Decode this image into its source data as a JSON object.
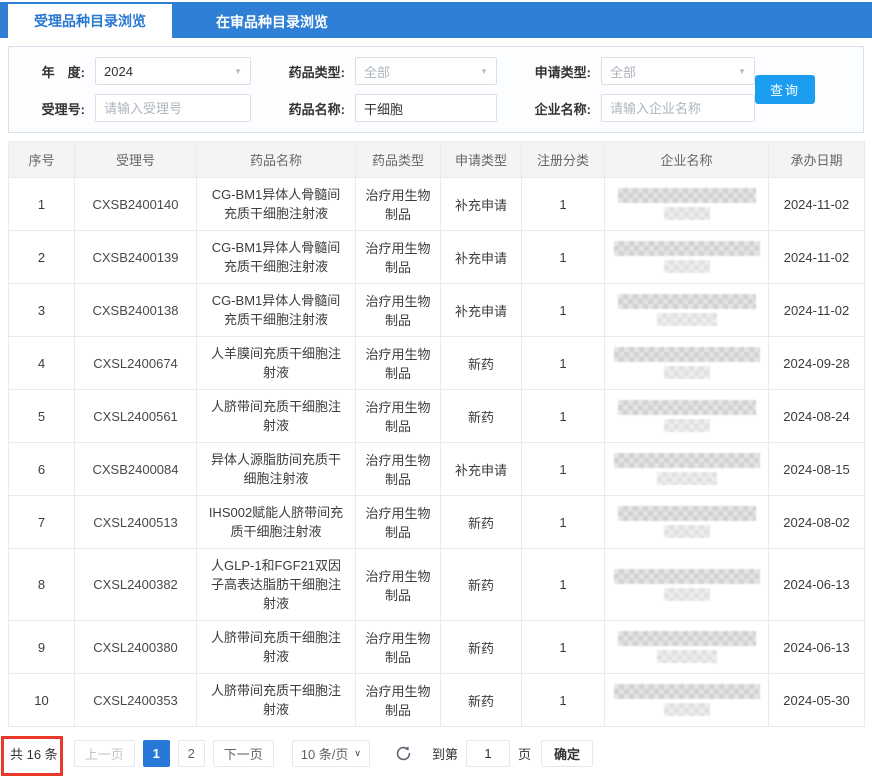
{
  "tabs": [
    {
      "label": "受理品种目录浏览",
      "active": true
    },
    {
      "label": "在审品种目录浏览",
      "active": false
    }
  ],
  "filters": {
    "year_label": "年　度:",
    "year_value": "2024",
    "drug_type_label": "药品类型:",
    "drug_type_value": "全部",
    "apply_type_label": "申请类型:",
    "apply_type_value": "全部",
    "accept_no_label": "受理号:",
    "accept_no_placeholder": "请输入受理号",
    "drug_name_label": "药品名称:",
    "drug_name_value": "干细胞",
    "company_label": "企业名称:",
    "company_placeholder": "请输入企业名称",
    "search_button": "查询"
  },
  "table": {
    "headers": [
      "序号",
      "受理号",
      "药品名称",
      "药品类型",
      "申请类型",
      "注册分类",
      "企业名称",
      "承办日期"
    ],
    "rows": [
      {
        "no": "1",
        "accept_no": "CXSB2400140",
        "drug_name": "CG-BM1异体人骨髓间充质干细胞注射液",
        "drug_type": "治疗用生物制品",
        "apply_type": "补充申请",
        "reg_class": "1",
        "date": "2024-11-02"
      },
      {
        "no": "2",
        "accept_no": "CXSB2400139",
        "drug_name": "CG-BM1异体人骨髓间充质干细胞注射液",
        "drug_type": "治疗用生物制品",
        "apply_type": "补充申请",
        "reg_class": "1",
        "date": "2024-11-02"
      },
      {
        "no": "3",
        "accept_no": "CXSB2400138",
        "drug_name": "CG-BM1异体人骨髓间充质干细胞注射液",
        "drug_type": "治疗用生物制品",
        "apply_type": "补充申请",
        "reg_class": "1",
        "date": "2024-11-02"
      },
      {
        "no": "4",
        "accept_no": "CXSL2400674",
        "drug_name": "人羊膜间充质干细胞注射液",
        "drug_type": "治疗用生物制品",
        "apply_type": "新药",
        "reg_class": "1",
        "date": "2024-09-28"
      },
      {
        "no": "5",
        "accept_no": "CXSL2400561",
        "drug_name": "人脐带间充质干细胞注射液",
        "drug_type": "治疗用生物制品",
        "apply_type": "新药",
        "reg_class": "1",
        "date": "2024-08-24"
      },
      {
        "no": "6",
        "accept_no": "CXSB2400084",
        "drug_name": "异体人源脂肪间充质干细胞注射液",
        "drug_type": "治疗用生物制品",
        "apply_type": "补充申请",
        "reg_class": "1",
        "date": "2024-08-15"
      },
      {
        "no": "7",
        "accept_no": "CXSL2400513",
        "drug_name": "IHS002赋能人脐带间充质干细胞注射液",
        "drug_type": "治疗用生物制品",
        "apply_type": "新药",
        "reg_class": "1",
        "date": "2024-08-02"
      },
      {
        "no": "8",
        "accept_no": "CXSL2400382",
        "drug_name": "人GLP-1和FGF21双因子高表达脂肪干细胞注射液",
        "drug_type": "治疗用生物制品",
        "apply_type": "新药",
        "reg_class": "1",
        "date": "2024-06-13"
      },
      {
        "no": "9",
        "accept_no": "CXSL2400380",
        "drug_name": "人脐带间充质干细胞注射液",
        "drug_type": "治疗用生物制品",
        "apply_type": "新药",
        "reg_class": "1",
        "date": "2024-06-13"
      },
      {
        "no": "10",
        "accept_no": "CXSL2400353",
        "drug_name": "人脐带间充质干细胞注射液",
        "drug_type": "治疗用生物制品",
        "apply_type": "新药",
        "reg_class": "1",
        "date": "2024-05-30"
      }
    ]
  },
  "pagination": {
    "total": "共 16 条",
    "prev": "上一页",
    "pages": [
      "1",
      "2"
    ],
    "active_page": "1",
    "next": "下一页",
    "page_size": "10 条/页",
    "goto_label": "到第",
    "goto_value": "1",
    "goto_suffix": "页",
    "confirm": "确定"
  },
  "colors": {
    "topbar_blue": "#2e7fd5",
    "search_button_blue": "#1b9df0",
    "active_page_blue": "#2878d8",
    "annotation_red": "#e8392b",
    "header_gray": "#f4f4f5",
    "border_gray": "#e9eaec"
  }
}
